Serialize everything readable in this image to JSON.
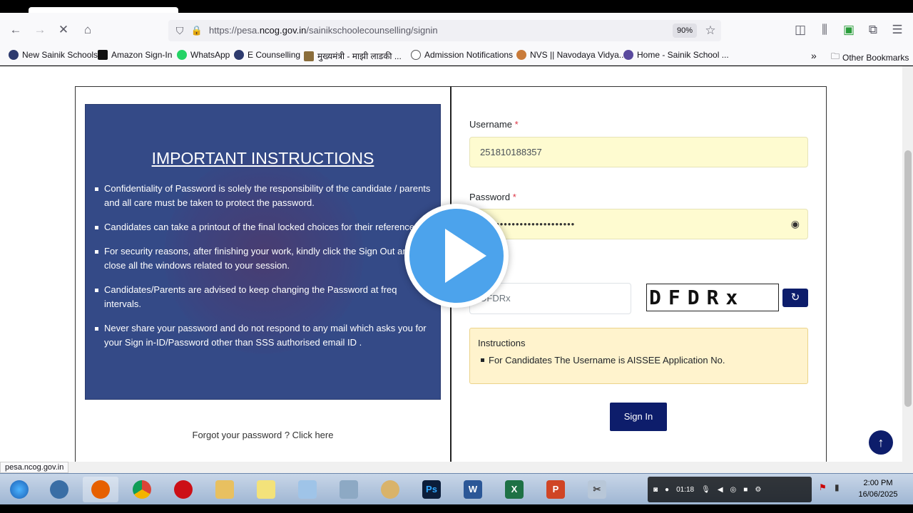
{
  "browser": {
    "url_host": "https://pesa.",
    "url_domain": "ncog.gov.in",
    "url_path": "/sainikschoolecounselling/signin",
    "zoom": "90%",
    "bookmarks": [
      {
        "label": "New Sainik Schools",
        "icon": "globe-icon"
      },
      {
        "label": "Amazon Sign-In",
        "icon": "amazon-icon"
      },
      {
        "label": "WhatsApp",
        "icon": "whatsapp-icon"
      },
      {
        "label": "E Counselling",
        "icon": "globe-icon"
      },
      {
        "label": "मुख्यमंत्री - माझी लाडकी ...",
        "icon": "emblem-icon"
      },
      {
        "label": "Admission Notifications",
        "icon": "globe-icon"
      },
      {
        "label": "NVS || Navodaya Vidya...",
        "icon": "nvs-icon"
      },
      {
        "label": "Home - Sainik School ...",
        "icon": "globe-icon"
      }
    ],
    "other_bookmarks": "Other Bookmarks",
    "status_url": "pesa.ncog.gov.in"
  },
  "instructions_panel": {
    "title": "IMPORTANT INSTRUCTIONS",
    "items": [
      "Confidentiality of Password is solely the responsibility of the candidate / parents and all care must be taken to protect the password.",
      "Candidates can take a printout of the final locked choices for their reference",
      "For security reasons, after finishing your work, kindly click the Sign Out and close all the windows related to your session.",
      "Candidates/Parents are advised to keep changing the Password at freq intervals.",
      "Never share your password and do not respond to any mail which asks you for your Sign in-ID/Password other than SSS authorised email ID ."
    ],
    "forgot_link": "Forgot your password ? Click here"
  },
  "form": {
    "username_label": "Username",
    "username_value": "251810188357",
    "password_label": "Password",
    "password_value": "••••••••••••••••••••••••",
    "required_mark": "*",
    "captcha_input_value": "DFDRx",
    "captcha_text": "DFDRx",
    "note_title": "Instructions",
    "note_item": "For Candidates The Username is AISSEE Application No.",
    "signin_label": "Sign In"
  },
  "taskbar": {
    "time": "2:00 PM",
    "date": "16/06/2025",
    "recording_time": "01:18"
  }
}
